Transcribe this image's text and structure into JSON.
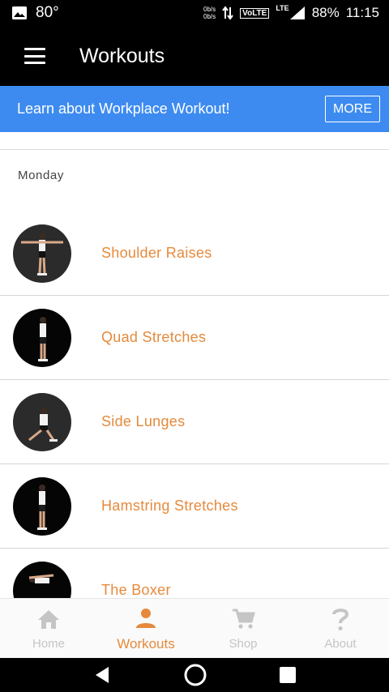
{
  "status_bar": {
    "temperature": "80°",
    "net_rate_up": "0b/s",
    "net_rate_down": "0b/s",
    "volte": "VoLTE",
    "lte": "LTE",
    "battery": "88%",
    "time": "11:15"
  },
  "app_bar": {
    "title": "Workouts"
  },
  "banner": {
    "text": "Learn about Workplace Workout!",
    "button_label": "MORE"
  },
  "day": {
    "label": "Monday"
  },
  "workouts": [
    {
      "name": "Shoulder Raises"
    },
    {
      "name": "Quad Stretches"
    },
    {
      "name": "Side Lunges"
    },
    {
      "name": "Hamstring Stretches"
    },
    {
      "name": "The Boxer"
    }
  ],
  "bottom_nav": {
    "items": [
      {
        "label": "Home",
        "icon": "home-icon"
      },
      {
        "label": "Workouts",
        "icon": "person-icon",
        "active": true
      },
      {
        "label": "Shop",
        "icon": "cart-icon"
      },
      {
        "label": "About",
        "icon": "question-icon"
      }
    ]
  },
  "colors": {
    "accent": "#e58a3c",
    "banner": "#3d8bf0",
    "app_bar": "#000000",
    "inactive_nav": "#c5c5c5"
  }
}
